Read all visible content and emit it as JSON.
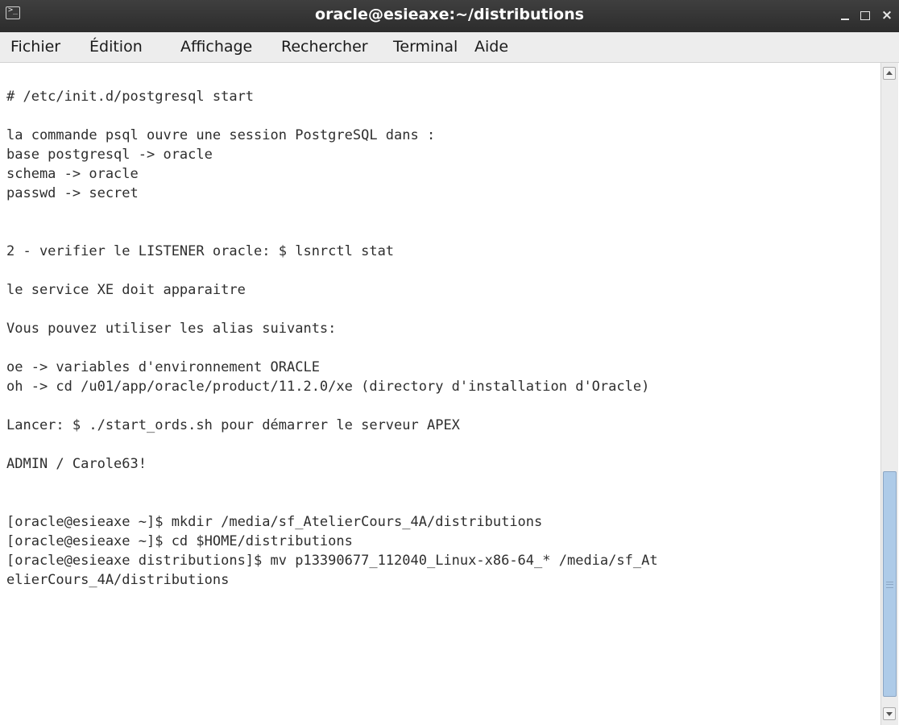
{
  "window": {
    "title": "oracle@esieaxe:~/distributions",
    "icon": "terminal-icon",
    "controls": {
      "minimize": "_",
      "maximize": "",
      "close": "×"
    }
  },
  "menubar": {
    "items": [
      {
        "label": "Fichier"
      },
      {
        "label": "Édition"
      },
      {
        "label": "Affichage"
      },
      {
        "label": "Rechercher"
      },
      {
        "label": "Terminal"
      },
      {
        "label": "Aide"
      }
    ]
  },
  "terminal": {
    "text": "# /etc/init.d/postgresql start\n\nla commande psql ouvre une session PostgreSQL dans :\nbase postgresql -> oracle\nschema -> oracle\npasswd -> secret\n\n\n2 - verifier le LISTENER oracle: $ lsnrctl stat\n\nle service XE doit apparaitre\n\nVous pouvez utiliser les alias suivants:\n\noe -> variables d'environnement ORACLE\noh -> cd /u01/app/oracle/product/11.2.0/xe (directory d'installation d'Oracle)\n\nLancer: $ ./start_ords.sh pour démarrer le serveur APEX\n\nADMIN / Carole63!\n\n\n[oracle@esieaxe ~]$ mkdir /media/sf_AtelierCours_4A/distributions\n[oracle@esieaxe ~]$ cd $HOME/distributions\n[oracle@esieaxe distributions]$ mv p13390677_112040_Linux-x86-64_* /media/sf_At\nelierCours_4A/distributions"
  },
  "scrollbar": {
    "position": 0.85
  },
  "colors": {
    "titlebar": "#333333",
    "menubar": "#ededed",
    "terminal_bg": "#ffffff",
    "terminal_fg": "#2e2e2e",
    "scrollbar_thumb": "#aecbe8"
  }
}
